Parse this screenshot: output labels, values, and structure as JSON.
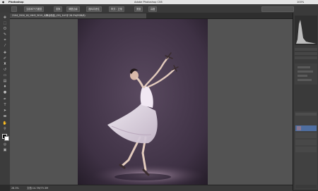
{
  "menubar": {
    "app_name": "Photoshop",
    "window_title": "Adobe Photoshop CS6",
    "status_text": "100%"
  },
  "options_bar": {
    "buttons": [
      "当前和下方图层",
      "变换",
      "调整边缘",
      "选择并遮住",
      "样式：正常",
      "宽度",
      "高度"
    ]
  },
  "document": {
    "tab_title": "2104_2016_18_19H3_3019_大舞台精品_(05)_1tif @ 28.3%(RGB/8)"
  },
  "status_bar": {
    "zoom": "28.3%",
    "doc_info": "文档:14.7M/75.3M"
  },
  "tools": [
    "move-icon",
    "marquee-icon",
    "lasso-icon",
    "quick-select-icon",
    "crop-icon",
    "eyedropper-icon",
    "healing-icon",
    "brush-icon",
    "stamp-icon",
    "history-brush-icon",
    "eraser-icon",
    "gradient-icon",
    "blur-icon",
    "dodge-icon",
    "pen-icon",
    "type-icon",
    "path-select-icon",
    "shape-icon",
    "hand-icon",
    "zoom-icon"
  ],
  "colors": {
    "foreground": "#111111",
    "background": "#ffffff",
    "workspace": "#535353",
    "photo_backdrop": "#4f3f54"
  }
}
